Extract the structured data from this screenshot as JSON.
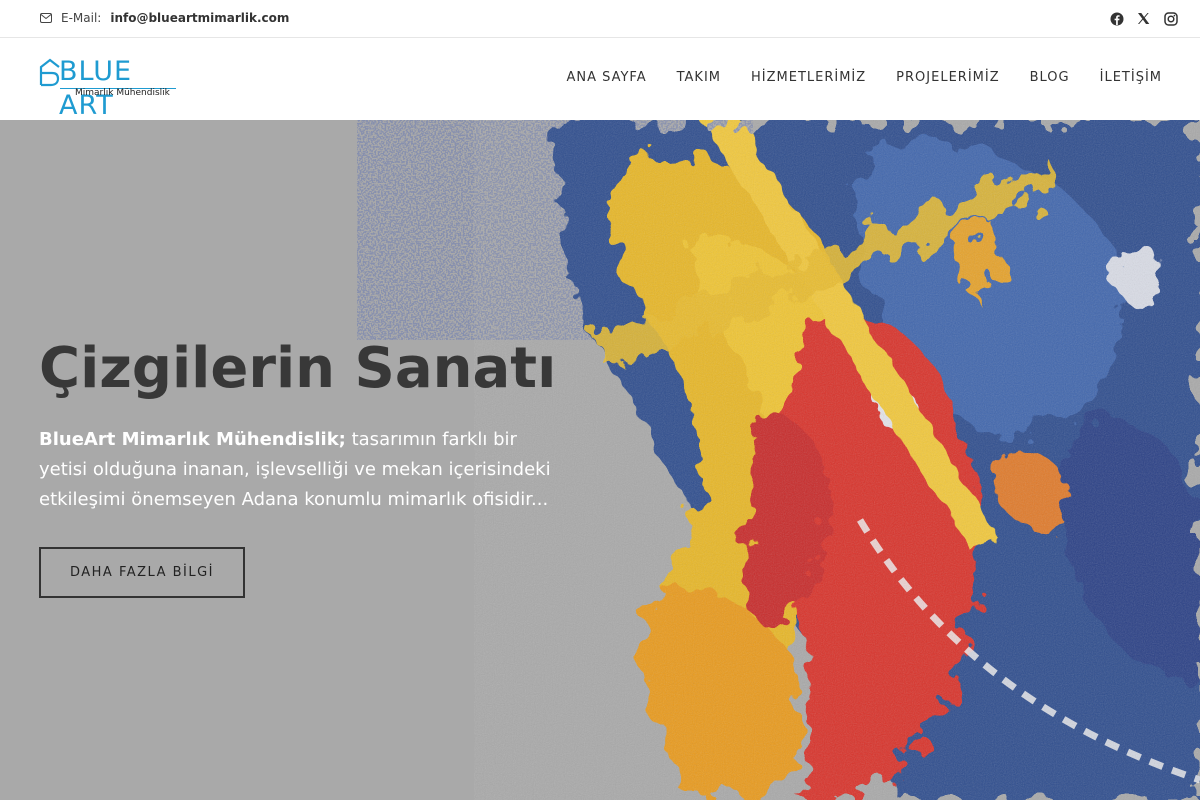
{
  "topbar": {
    "email_label": "E-Mail:",
    "email_value": "info@blueartmimarlik.com",
    "socials": [
      {
        "icon": "facebook-icon"
      },
      {
        "icon": "x-twitter-icon"
      },
      {
        "icon": "instagram-icon"
      }
    ]
  },
  "logo": {
    "word": "BLUE ART",
    "sub": "Mimarlık Mühendislik",
    "color": "#1f9bd1"
  },
  "nav": {
    "items": [
      "ANA SAYFA",
      "TAKIM",
      "HİZMETLERİMİZ",
      "PROJELERİMİZ",
      "BLOG",
      "İLETİŞİM"
    ]
  },
  "hero": {
    "title": "Çizgilerin Sanatı",
    "lead_bold": "BlueArt Mimarlık Mühendislik;",
    "lead_text": " tasarımın farklı bir yetisi olduğuna inanan, işlevselliği ve mekan içerisindeki etkileşimi önemseyen Adana konumlu mimarlık ofisidir...",
    "button_label": "DAHA FAZLA BİLGİ"
  }
}
